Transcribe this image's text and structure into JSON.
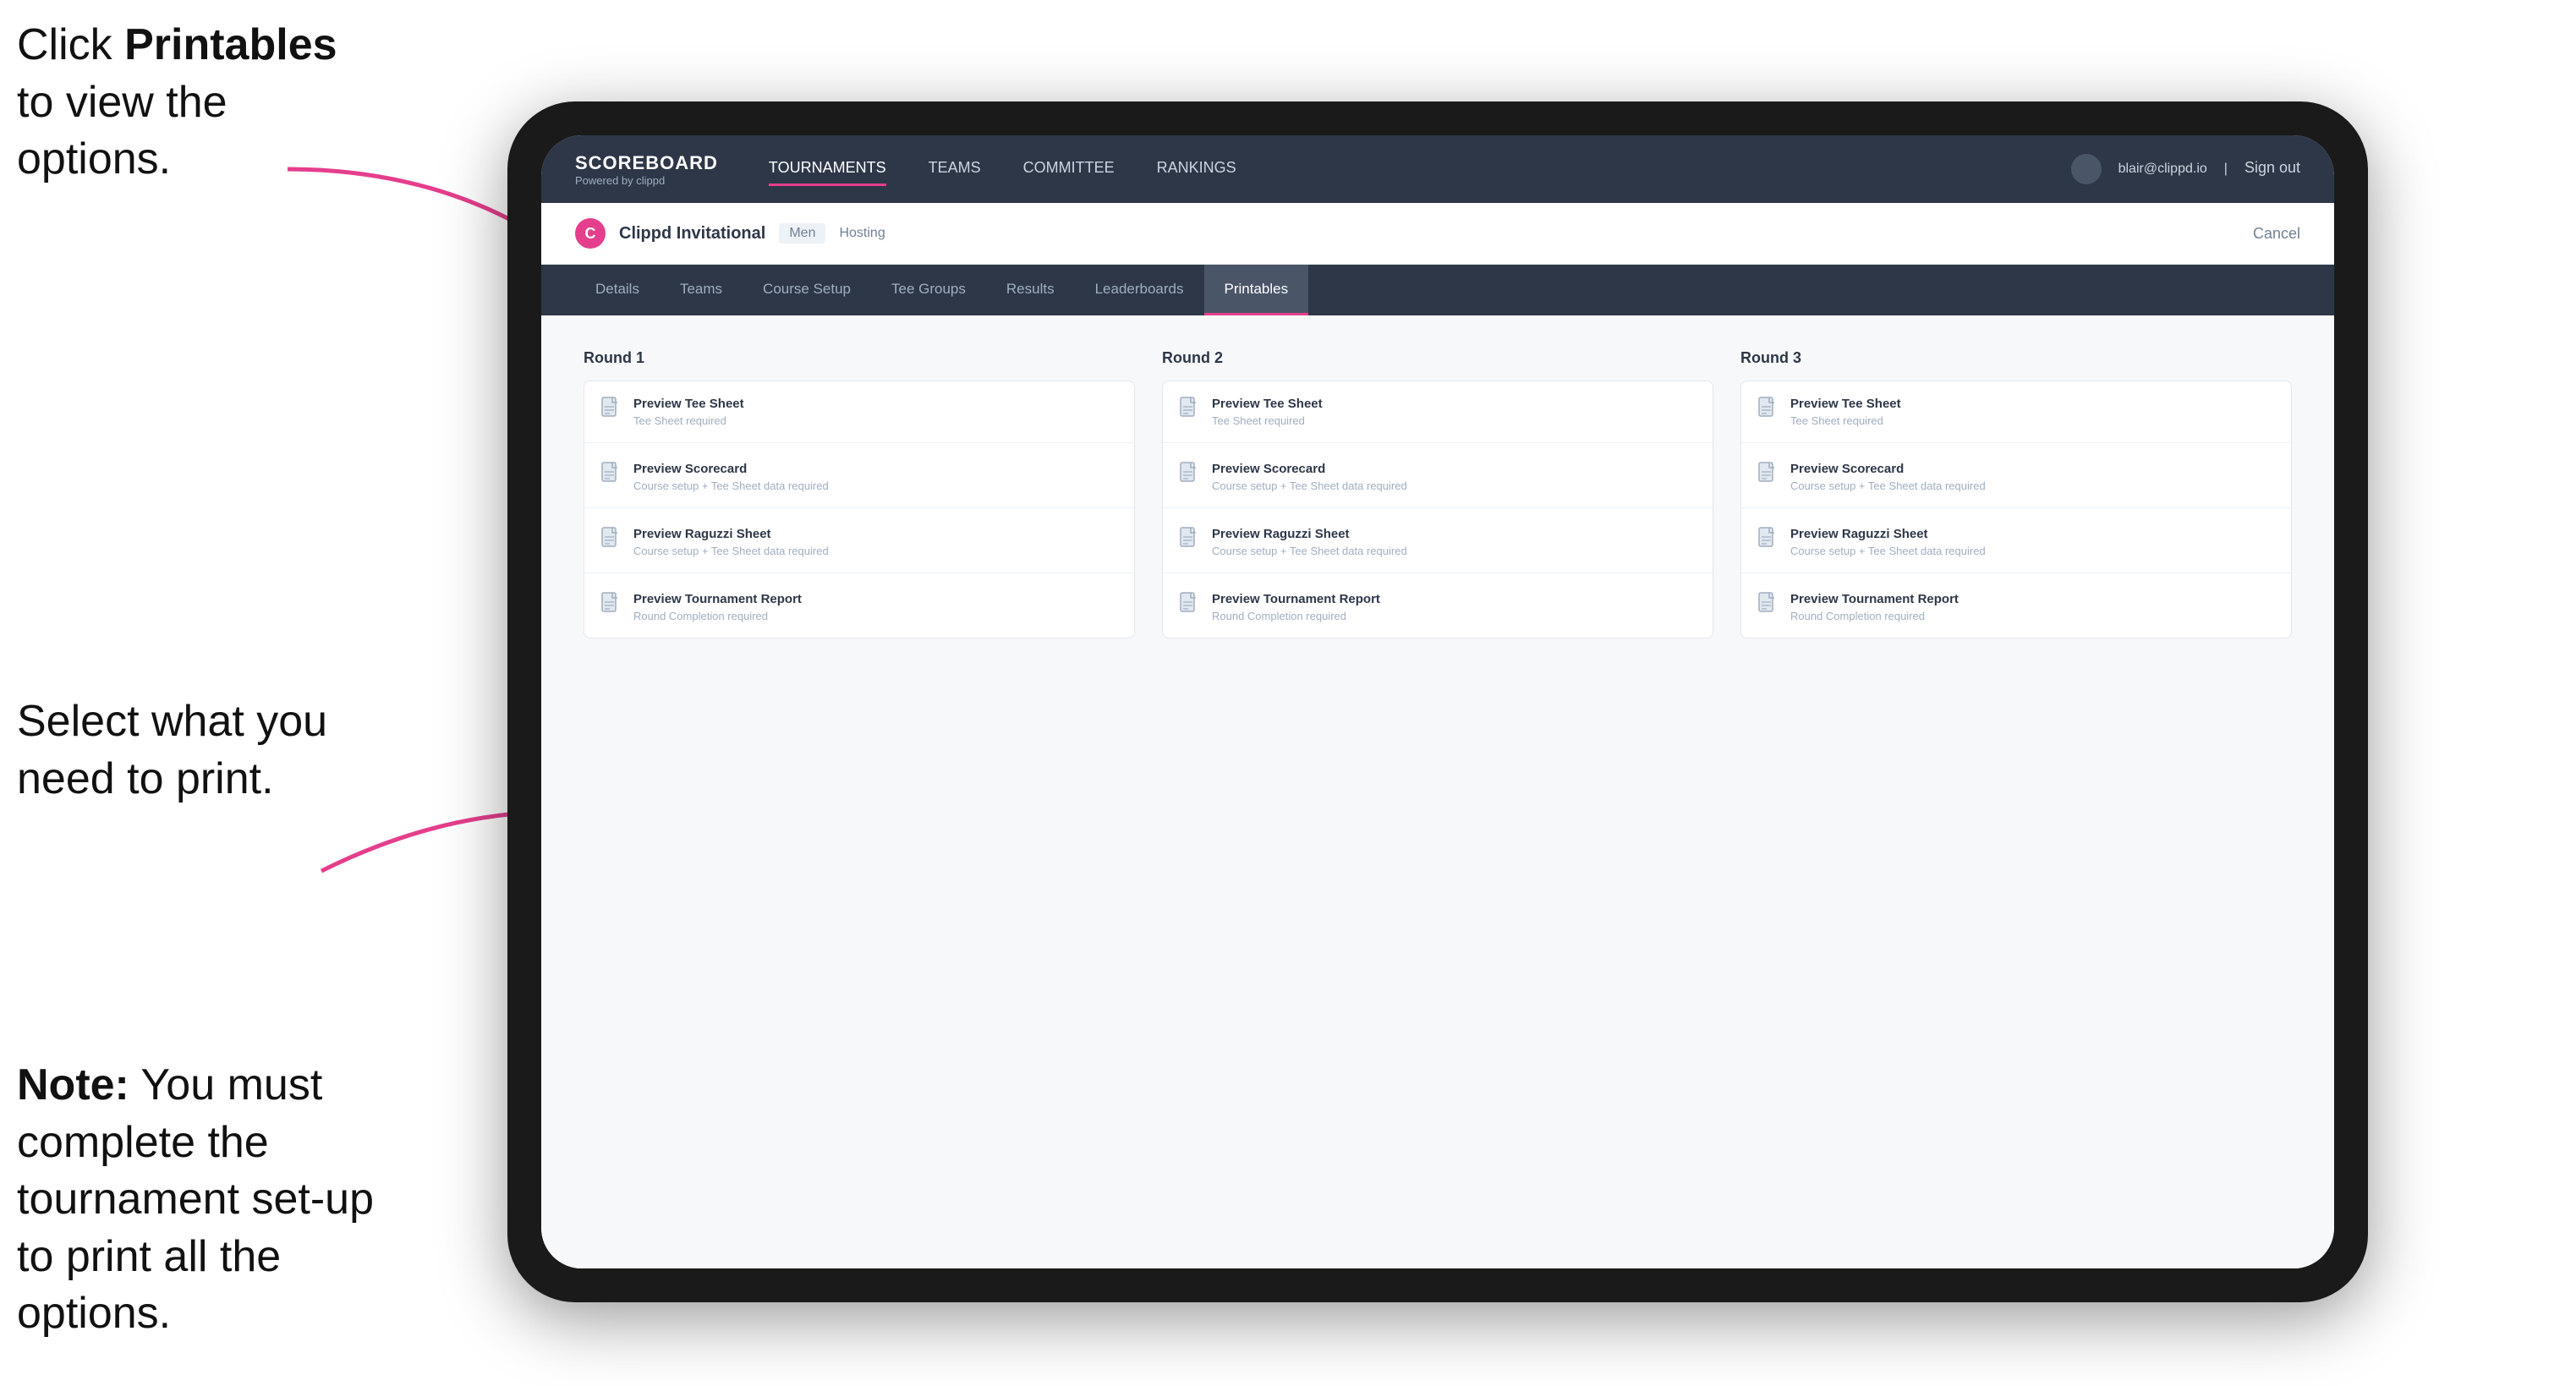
{
  "instructions": {
    "top": "Click ",
    "top_bold": "Printables",
    "top_rest": " to view the options.",
    "middle": "Select what you need to print.",
    "bottom_bold": "Note:",
    "bottom_rest": " You must complete the tournament set-up to print all the options."
  },
  "nav": {
    "brand": "SCOREBOARD",
    "brand_sub": "Powered by clippd",
    "links": [
      "TOURNAMENTS",
      "TEAMS",
      "COMMITTEE",
      "RANKINGS"
    ],
    "active_link": "TOURNAMENTS",
    "user_email": "blair@clippd.io",
    "sign_out": "Sign out"
  },
  "tournament": {
    "name": "Clippd Invitational",
    "tag": "Men",
    "hosting": "Hosting",
    "cancel": "Cancel"
  },
  "sub_nav": {
    "tabs": [
      "Details",
      "Teams",
      "Course Setup",
      "Tee Groups",
      "Results",
      "Leaderboards",
      "Printables"
    ],
    "active_tab": "Printables"
  },
  "rounds": [
    {
      "title": "Round 1",
      "cards": [
        {
          "title": "Preview Tee Sheet",
          "sub": "Tee Sheet required"
        },
        {
          "title": "Preview Scorecard",
          "sub": "Course setup + Tee Sheet data required"
        },
        {
          "title": "Preview Raguzzi Sheet",
          "sub": "Course setup + Tee Sheet data required"
        },
        {
          "title": "Preview Tournament Report",
          "sub": "Round Completion required"
        }
      ]
    },
    {
      "title": "Round 2",
      "cards": [
        {
          "title": "Preview Tee Sheet",
          "sub": "Tee Sheet required"
        },
        {
          "title": "Preview Scorecard",
          "sub": "Course setup + Tee Sheet data required"
        },
        {
          "title": "Preview Raguzzi Sheet",
          "sub": "Course setup + Tee Sheet data required"
        },
        {
          "title": "Preview Tournament Report",
          "sub": "Round Completion required"
        }
      ]
    },
    {
      "title": "Round 3",
      "cards": [
        {
          "title": "Preview Tee Sheet",
          "sub": "Tee Sheet required"
        },
        {
          "title": "Preview Scorecard",
          "sub": "Course setup + Tee Sheet data required"
        },
        {
          "title": "Preview Raguzzi Sheet",
          "sub": "Course setup + Tee Sheet data required"
        },
        {
          "title": "Preview Tournament Report",
          "sub": "Round Completion required"
        }
      ]
    }
  ],
  "colors": {
    "accent": "#e53e8c",
    "nav_bg": "#2d3748",
    "card_bg": "#ffffff"
  }
}
